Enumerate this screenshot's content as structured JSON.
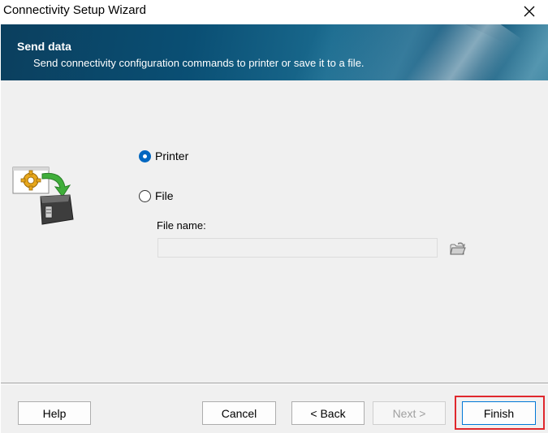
{
  "window": {
    "title": "Connectivity Setup Wizard",
    "close_icon": "close-icon"
  },
  "header": {
    "title": "Send data",
    "subtitle": "Send connectivity configuration commands to printer or save it to a file."
  },
  "options": {
    "printer_label": "Printer",
    "file_label": "File",
    "selected": "Printer"
  },
  "file": {
    "name_label": "File name:",
    "name_value": "",
    "browse_icon": "open-folder-icon"
  },
  "buttons": {
    "help": "Help",
    "cancel": "Cancel",
    "back": "< Back",
    "next": "Next >",
    "finish": "Finish"
  },
  "colors": {
    "accent": "#0067c0",
    "header_bg": "#0a4f74",
    "highlight": "#e0282d"
  }
}
